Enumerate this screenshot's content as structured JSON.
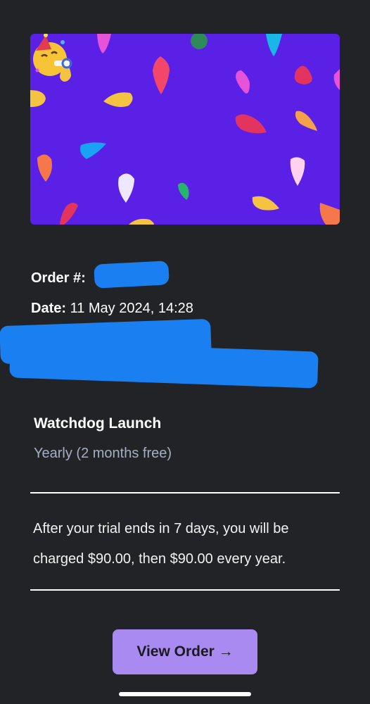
{
  "hero": {
    "background": "#5b20e6",
    "emoji": "party-face-icon"
  },
  "order": {
    "number_label": "Order #:",
    "date_label": "Date:",
    "date_value": "11 May 2024, 14:28"
  },
  "product": {
    "name": "Watchdog Launch",
    "plan": "Yearly (2 months free)"
  },
  "trial": {
    "line1": "After your trial ends in 7 days, you will be",
    "line2": "charged $90.00, then $90.00 every year."
  },
  "actions": {
    "view_order_label": "View Order →"
  },
  "colors": {
    "page_bg": "#222326",
    "button_bg": "#a98af0",
    "redaction": "#1a7ff0",
    "muted_text": "#a7aec4"
  }
}
